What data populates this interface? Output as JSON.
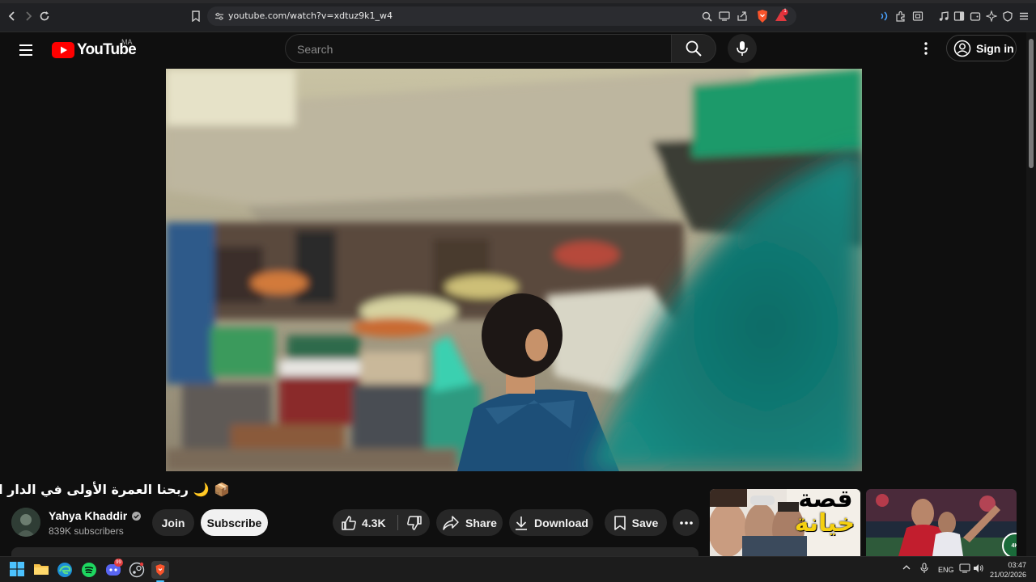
{
  "browser": {
    "url": "youtube.com/watch?v=xdtuz9k1_w4",
    "shield_badge_count": "1"
  },
  "header": {
    "logo_text": "YouTube",
    "region": "MA",
    "search_placeholder": "Search",
    "sign_in_label": "Sign in"
  },
  "video": {
    "title": "📦 🌙 ربحنا العمرة الأولى في الدار البيضاء",
    "channel_name": "Yahya Khaddir",
    "subscribers": "839K subscribers",
    "join_label": "Join",
    "subscribe_label": "Subscribe",
    "like_count": "4.3K",
    "share_label": "Share",
    "download_label": "Download",
    "save_label": "Save"
  },
  "recommended": [
    {
      "thumbnail_text_line1": "قصة",
      "thumbnail_text_line2": "خيانة"
    },
    {
      "thumbnail_badge": "4K"
    }
  ],
  "taskbar": {
    "language": "ENG",
    "time": "03:47",
    "date": "21/02/2026",
    "discord_badge": "99"
  },
  "colors": {
    "youtube_red": "#ff0000",
    "background": "#0f0f0f",
    "pill": "#272727",
    "subscribe_bg": "#f1f1f1",
    "brave_orange": "#fb542b"
  }
}
